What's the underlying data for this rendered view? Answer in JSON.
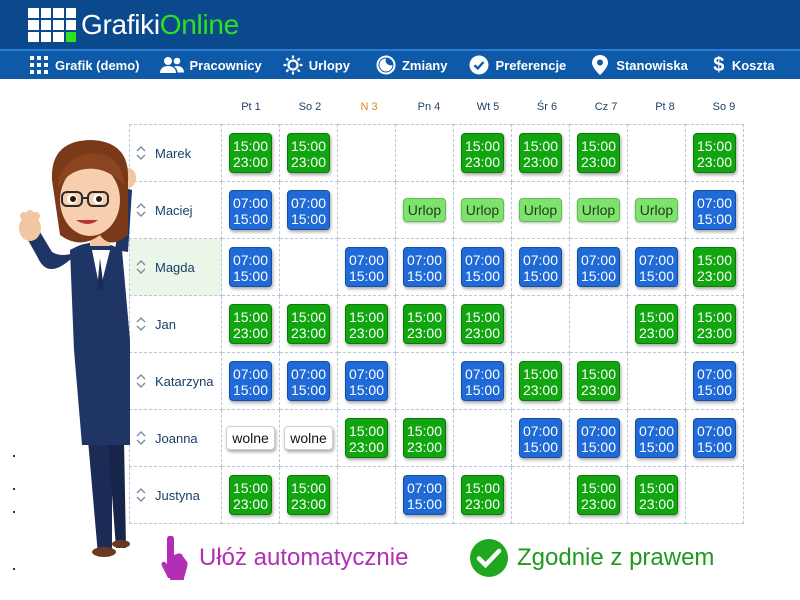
{
  "header": {
    "logo_part1": "Grafiki",
    "logo_part2": "Online"
  },
  "nav": {
    "items": [
      {
        "label": "Grafik (demo)",
        "icon": "grid-icon"
      },
      {
        "label": "Pracownicy",
        "icon": "users-icon"
      },
      {
        "label": "Urlopy",
        "icon": "sun-icon"
      },
      {
        "label": "Zmiany",
        "icon": "moon-icon"
      },
      {
        "label": "Preferencje",
        "icon": "check-circle-icon"
      },
      {
        "label": "Stanowiska",
        "icon": "map-pin-icon"
      },
      {
        "label": "Koszta",
        "icon": "dollar-icon"
      }
    ]
  },
  "days": [
    "Pt 1",
    "So 2",
    "N 3",
    "Pn 4",
    "Wt 5",
    "Śr 6",
    "Cz 7",
    "Pt 8",
    "So 9"
  ],
  "schedule": [
    {
      "name": "Marek",
      "cells": [
        {
          "t": "green",
          "a": "15:00",
          "b": "23:00"
        },
        {
          "t": "green",
          "a": "15:00",
          "b": "23:00"
        },
        {
          "t": "empty"
        },
        {
          "t": "empty"
        },
        {
          "t": "green",
          "a": "15:00",
          "b": "23:00"
        },
        {
          "t": "green",
          "a": "15:00",
          "b": "23:00"
        },
        {
          "t": "green",
          "a": "15:00",
          "b": "23:00"
        },
        {
          "t": "empty"
        },
        {
          "t": "green",
          "a": "15:00",
          "b": "23:00"
        }
      ]
    },
    {
      "name": "Maciej",
      "cells": [
        {
          "t": "blue",
          "a": "07:00",
          "b": "15:00"
        },
        {
          "t": "blue",
          "a": "07:00",
          "b": "15:00"
        },
        {
          "t": "empty"
        },
        {
          "t": "urlop",
          "label": "Urlop"
        },
        {
          "t": "urlop",
          "label": "Urlop"
        },
        {
          "t": "urlop",
          "label": "Urlop"
        },
        {
          "t": "urlop",
          "label": "Urlop"
        },
        {
          "t": "urlop",
          "label": "Urlop"
        },
        {
          "t": "blue",
          "a": "07:00",
          "b": "15:00"
        }
      ]
    },
    {
      "name": "Magda",
      "cells": [
        {
          "t": "blue",
          "a": "07:00",
          "b": "15:00"
        },
        {
          "t": "empty"
        },
        {
          "t": "blue",
          "a": "07:00",
          "b": "15:00"
        },
        {
          "t": "blue",
          "a": "07:00",
          "b": "15:00"
        },
        {
          "t": "blue",
          "a": "07:00",
          "b": "15:00"
        },
        {
          "t": "blue",
          "a": "07:00",
          "b": "15:00"
        },
        {
          "t": "blue",
          "a": "07:00",
          "b": "15:00"
        },
        {
          "t": "blue",
          "a": "07:00",
          "b": "15:00"
        },
        {
          "t": "green",
          "a": "15:00",
          "b": "23:00"
        }
      ]
    },
    {
      "name": "Jan",
      "cells": [
        {
          "t": "green",
          "a": "15:00",
          "b": "23:00"
        },
        {
          "t": "green",
          "a": "15:00",
          "b": "23:00"
        },
        {
          "t": "green",
          "a": "15:00",
          "b": "23:00"
        },
        {
          "t": "green",
          "a": "15:00",
          "b": "23:00"
        },
        {
          "t": "green",
          "a": "15:00",
          "b": "23:00"
        },
        {
          "t": "empty"
        },
        {
          "t": "empty"
        },
        {
          "t": "green",
          "a": "15:00",
          "b": "23:00"
        },
        {
          "t": "green",
          "a": "15:00",
          "b": "23:00"
        }
      ]
    },
    {
      "name": "Katarzyna",
      "cells": [
        {
          "t": "blue",
          "a": "07:00",
          "b": "15:00"
        },
        {
          "t": "blue",
          "a": "07:00",
          "b": "15:00"
        },
        {
          "t": "blue",
          "a": "07:00",
          "b": "15:00"
        },
        {
          "t": "empty"
        },
        {
          "t": "blue",
          "a": "07:00",
          "b": "15:00"
        },
        {
          "t": "green",
          "a": "15:00",
          "b": "23:00"
        },
        {
          "t": "green",
          "a": "15:00",
          "b": "23:00"
        },
        {
          "t": "empty"
        },
        {
          "t": "blue",
          "a": "07:00",
          "b": "15:00"
        }
      ]
    },
    {
      "name": "Joanna",
      "cells": [
        {
          "t": "wolne",
          "label": "wolne"
        },
        {
          "t": "wolne",
          "label": "wolne"
        },
        {
          "t": "green",
          "a": "15:00",
          "b": "23:00"
        },
        {
          "t": "green",
          "a": "15:00",
          "b": "23:00"
        },
        {
          "t": "empty"
        },
        {
          "t": "blue",
          "a": "07:00",
          "b": "15:00"
        },
        {
          "t": "blue",
          "a": "07:00",
          "b": "15:00"
        },
        {
          "t": "blue",
          "a": "07:00",
          "b": "15:00"
        },
        {
          "t": "blue",
          "a": "07:00",
          "b": "15:00"
        }
      ]
    },
    {
      "name": "Justyna",
      "cells": [
        {
          "t": "green",
          "a": "15:00",
          "b": "23:00"
        },
        {
          "t": "green",
          "a": "15:00",
          "b": "23:00"
        },
        {
          "t": "empty"
        },
        {
          "t": "blue",
          "a": "07:00",
          "b": "15:00"
        },
        {
          "t": "green",
          "a": "15:00",
          "b": "23:00"
        },
        {
          "t": "empty"
        },
        {
          "t": "green",
          "a": "15:00",
          "b": "23:00"
        },
        {
          "t": "green",
          "a": "15:00",
          "b": "23:00"
        },
        {
          "t": "empty"
        }
      ]
    }
  ],
  "bottom": {
    "auto_label": "Ułóż automatycznie",
    "law_label": "Zgodnie z prawem"
  },
  "colors": {
    "header_bg": "#0a4a8c",
    "nav_bg": "#0f5aa8",
    "shift_green": "#11a60f",
    "shift_blue": "#1f6ad6",
    "urlop_bg": "#7fe26e",
    "auto_color": "#b02fb4",
    "law_color": "#1e9a1e"
  }
}
